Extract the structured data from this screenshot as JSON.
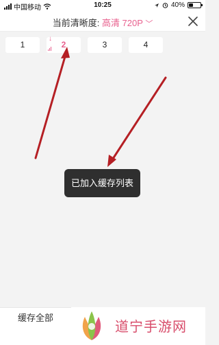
{
  "status_bar": {
    "carrier": "中国移动",
    "time": "10:25",
    "battery": "40%",
    "battery_level": 0.4
  },
  "header": {
    "quality_label": "当前清晰度:",
    "quality_value": "高清 720P",
    "chevron": "﹀"
  },
  "episodes": [
    {
      "label": "1",
      "downloading": false
    },
    {
      "label": "2",
      "downloading": true
    },
    {
      "label": "3",
      "downloading": false
    },
    {
      "label": "4",
      "downloading": false
    }
  ],
  "toast": {
    "message": "已加入缓存列表"
  },
  "bottom": {
    "save_all_label": "缓存全部"
  },
  "brand": {
    "text": "道宁手游网"
  },
  "colors": {
    "accent": "#e8608e",
    "arrow": "#b51f24",
    "brand_text": "#d84d6b"
  }
}
